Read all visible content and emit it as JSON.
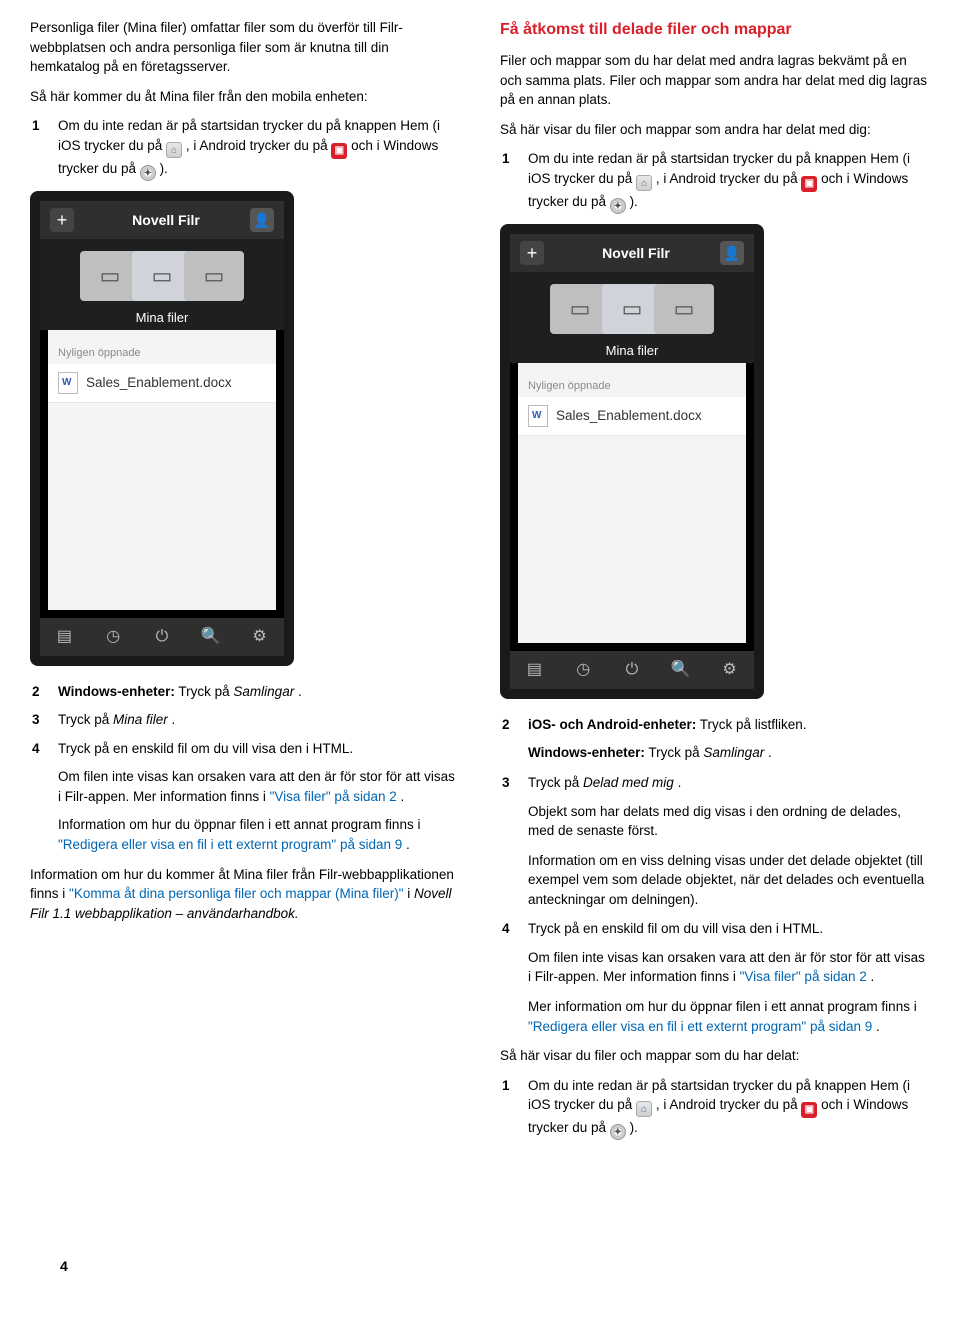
{
  "left": {
    "intro": "Personliga filer (Mina filer) omfattar filer som du överför till Filr-webbplatsen och andra personliga filer som är knutna till din hemkatalog på en företagsserver.",
    "lead2": "Så här kommer du åt Mina filer från den mobila enheten:",
    "step1_a": "Om du inte redan är på startsidan trycker du på knappen Hem (i iOS trycker du på ",
    "step1_b": ", i Android trycker du på ",
    "step1_c": " och i Windows trycker du på ",
    "step1_d": ").",
    "phone_title": "Novell Filr",
    "mina_filer": "Mina filer",
    "nyligen": "Nyligen öppnade",
    "doc": "Sales_Enablement.docx",
    "step2_a": "Windows-enheter:",
    "step2_b": " Tryck på ",
    "step2_c": "Samlingar",
    "step2_d": ".",
    "step3_a": "Tryck på ",
    "step3_b": "Mina filer",
    "step3_c": ".",
    "step4": "Tryck på en enskild fil om du vill visa den i HTML.",
    "step4_p1_a": "Om filen inte visas kan orsaken vara att den är för stor för att visas i Filr-appen. Mer information finns i ",
    "step4_p1_link": "\"Visa filer\" på sidan 2",
    "step4_p1_b": ".",
    "step4_p2_a": "Information om hur du öppnar filen i ett annat program finns i ",
    "step4_p2_link": "\"Redigera eller visa en fil i ett externt program\" på sidan 9",
    "step4_p2_b": ".",
    "foot_a": "Information om hur du kommer åt Mina filer från Filr-webbapplikationen finns i ",
    "foot_link1": "\"Komma åt dina personliga filer och mappar (Mina filer)\"",
    "foot_b": " i ",
    "foot_it": "Novell Filr 1.1 webbapplikation – användarhandbok.",
    "page_num": "4"
  },
  "right": {
    "h": "Få åtkomst till delade filer och mappar",
    "p1": "Filer och mappar som du har delat med andra lagras bekvämt på en och samma plats. Filer och mappar som andra har delat med dig lagras på en annan plats.",
    "p2": "Så här visar du filer och mappar som andra har delat med dig:",
    "step1_a": "Om du inte redan är på startsidan trycker du på knappen Hem (i iOS trycker du på ",
    "step1_b": ", i Android trycker du på ",
    "step1_c": " och i Windows trycker du på ",
    "step1_d": ").",
    "phone_title": "Novell Filr",
    "mina_filer": "Mina filer",
    "nyligen": "Nyligen öppnade",
    "doc": "Sales_Enablement.docx",
    "s2_a": "iOS- och Android-enheter:",
    "s2_b": " Tryck på listfliken.",
    "s2_w_a": "Windows-enheter:",
    "s2_w_b": " Tryck på ",
    "s2_w_c": "Samlingar",
    "s2_w_d": ".",
    "s3_a": "Tryck på ",
    "s3_b": "Delad med mig",
    "s3_c": ".",
    "s3_p1": "Objekt som har delats med dig visas i den ordning de delades, med de senaste först.",
    "s3_p2": "Information om en viss delning visas under det delade objektet (till exempel vem som delade objektet, när det delades och eventuella anteckningar om delningen).",
    "s4": "Tryck på en enskild fil om du vill visa den i HTML.",
    "s4_p1_a": "Om filen inte visas kan orsaken vara att den är för stor för att visas i Filr-appen. Mer information finns i ",
    "s4_p1_link": "\"Visa filer\" på sidan 2",
    "s4_p1_b": ".",
    "s4_p2_a": "Mer information om hur du öppnar filen i ett annat program finns i ",
    "s4_p2_link": "\"Redigera eller visa en fil i ett externt program\" på sidan 9",
    "s4_p2_b": ".",
    "tail": "Så här visar du filer och mappar som du har delat:",
    "t1_a": "Om du inte redan är på startsidan trycker du på knappen Hem (i iOS trycker du på ",
    "t1_b": ", i Android trycker du på ",
    "t1_c": " och i Windows trycker du på ",
    "t1_d": ")."
  }
}
